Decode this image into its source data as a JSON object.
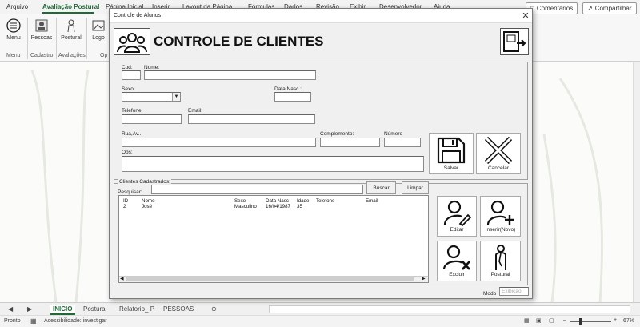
{
  "ribbon": {
    "tabs": [
      "Arquivo",
      "Avaliação Postural",
      "Página Inicial",
      "Inserir",
      "Layout da Página",
      "Fórmulas",
      "Dados",
      "Revisão",
      "Exibir",
      "Desenvolvedor",
      "Ajuda"
    ],
    "comments_label": "Comentários",
    "share_label": "Compartilhar",
    "groups": {
      "menu_btn": "Menu",
      "menu_group": "Menu",
      "pessoas_btn": "Pessoas",
      "cadastro_group": "Cadastro",
      "postural_btn": "Postural",
      "avaliacoes_group": "Avaliações",
      "logo_btn": "Logo",
      "op_group": "Op"
    }
  },
  "dialog": {
    "title": "Controle de Alunos",
    "heading": "CONTROLE DE CLIENTES",
    "fields": {
      "cod": {
        "label": "Cod:",
        "value": ""
      },
      "nome": {
        "label": "Nome:",
        "value": ""
      },
      "sexo": {
        "label": "Sexo:",
        "value": ""
      },
      "data_nasc": {
        "label": "Data Nasc.:",
        "value": ""
      },
      "telefone": {
        "label": "Telefone:",
        "value": ""
      },
      "email": {
        "label": "Email:",
        "value": ""
      },
      "rua": {
        "label": "Rua,Av...",
        "value": ""
      },
      "complemento": {
        "label": "Complemento:",
        "value": ""
      },
      "numero": {
        "label": "Número",
        "value": ""
      },
      "obs": {
        "label": "Obs:",
        "value": ""
      }
    },
    "buttons": {
      "salvar": "Salvar",
      "cancelar": "Cancelar",
      "buscar": "Buscar",
      "limpar": "Limpar",
      "editar": "Editar",
      "inserir": "Inserir(Novo)",
      "excluir": "Excluir",
      "postural": "Postural"
    },
    "clientes": {
      "frame_label": "Clientes Cadastrados:",
      "search_label": "Pesquisar:",
      "search_value": "",
      "columns": [
        "ID",
        "Nome",
        "Sexo",
        "Data Nasc",
        "Idade",
        "Telefone",
        "Email"
      ],
      "rows": [
        [
          "2",
          "José",
          "Masculino",
          "16/04/1987",
          "35",
          "",
          ""
        ]
      ]
    },
    "modo_label": "Modo",
    "modo_value": "Exibição"
  },
  "sheet_tabs": [
    "INICIO",
    "Postural",
    "Relatorio_ P",
    "PESSOAS"
  ],
  "status": {
    "ready": "Pronto",
    "accessibility": "Acessibilidade: investigar",
    "zoom": "67%"
  },
  "colors": {
    "accent": "#1e6b38"
  }
}
